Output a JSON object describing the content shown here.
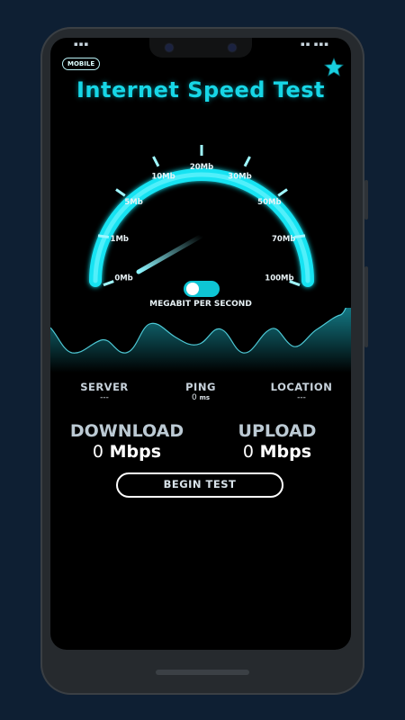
{
  "app": {
    "title": "Internet Speed Test",
    "badge": "MOBILE",
    "star_icon": "star-icon"
  },
  "gauge": {
    "ticks": [
      "0Mb",
      "1Mb",
      "5Mb",
      "10Mb",
      "20Mb",
      "30Mb",
      "50Mb",
      "70Mb",
      "100Mb"
    ],
    "unit_label": "MEGABIT PER SECOND",
    "needle_value_mb": 0,
    "accent_color": "#17d6e6"
  },
  "stats": {
    "server": {
      "label": "SERVER",
      "value": "---"
    },
    "ping": {
      "label": "PING",
      "value": "0",
      "unit": "ms"
    },
    "location": {
      "label": "LOCATION",
      "value": "---"
    }
  },
  "speeds": {
    "download": {
      "label": "DOWNLOAD",
      "value": "0",
      "unit": "Mbps"
    },
    "upload": {
      "label": "UPLOAD",
      "value": "0",
      "unit": "Mbps"
    }
  },
  "actions": {
    "begin_test_label": "BEGIN TEST"
  }
}
